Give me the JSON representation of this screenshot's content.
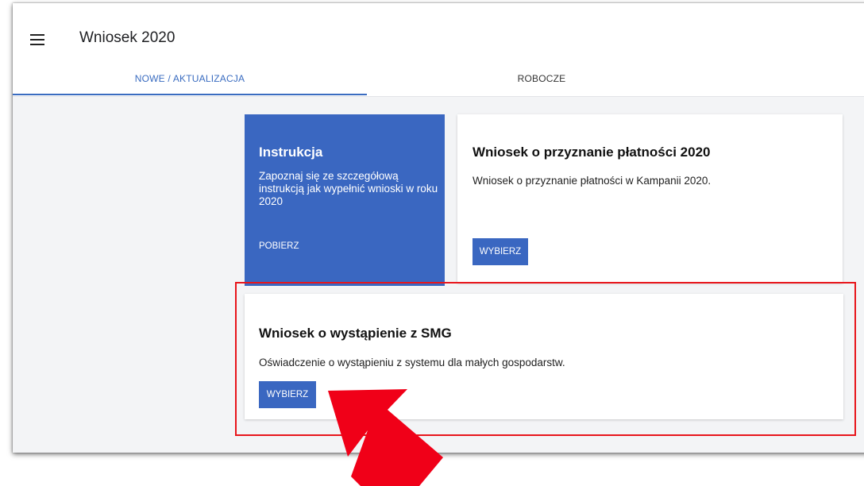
{
  "header": {
    "title": "Wniosek 2020",
    "menu_icon": "hamburger-menu-icon"
  },
  "tabs": [
    {
      "label": "NOWE / AKTUALIZACJA",
      "active": true
    },
    {
      "label": "ROBOCZE",
      "active": false
    }
  ],
  "instruction_card": {
    "title": "Instrukcja",
    "text": "Zapoznaj się ze szczegółową instrukcją jak wypełnić wnioski w roku 2020",
    "link": "POBIERZ"
  },
  "cards": [
    {
      "title": "Wniosek o przyznanie płatności 2020",
      "description": "Wniosek o przyznanie płatności w Kampanii 2020.",
      "button": "WYBIERZ"
    },
    {
      "title": "Wniosek o wystąpienie z SMG",
      "description": "Oświadczenie o wystąpieniu z systemu dla małych gospodarstw.",
      "button": "WYBIERZ"
    }
  ],
  "colors": {
    "accent": "#3a67c1",
    "highlight": "#e8151b",
    "background": "#f3f4f6"
  }
}
